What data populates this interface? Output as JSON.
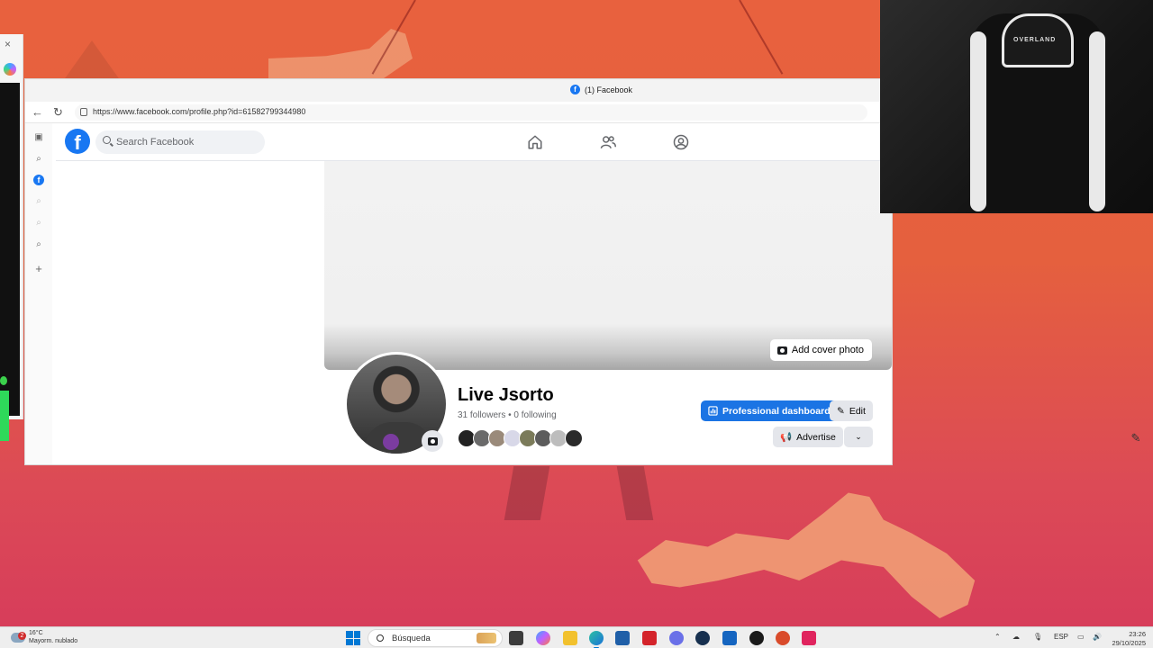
{
  "browser": {
    "tab_title": "(1) Facebook",
    "url": "https://www.facebook.com/profile.php?id=61582799344980"
  },
  "facebook": {
    "search_placeholder": "Search Facebook",
    "add_cover_photo": "Add cover photo",
    "profile_name": "Live Jsorto",
    "followers_text": "31 followers • 0 following",
    "professional_dashboard": "Professional dashboard",
    "edit": "Edit",
    "advertise": "Advertise",
    "nav_icons": [
      "home-icon",
      "friends-icon",
      "profile-icon"
    ],
    "friend_avatar_colors": [
      "#222222",
      "#6a6a6a",
      "#9a8a7a",
      "#d8d8e8",
      "#7b7b5a",
      "#5c5c5c",
      "#bdbdbd",
      "#2a2a2a"
    ]
  },
  "webcam": {
    "chair_brand": "OVERLAND"
  },
  "taskbar": {
    "weather_temp": "16°C",
    "weather_desc": "Mayorm. nublado",
    "notification_count": "2",
    "search_label": "Búsqueda",
    "language": "ESP",
    "time": "23:26",
    "date": "29/10/2025"
  },
  "colors": {
    "facebook_blue": "#1877f2",
    "button_blue": "#1b74e4"
  }
}
